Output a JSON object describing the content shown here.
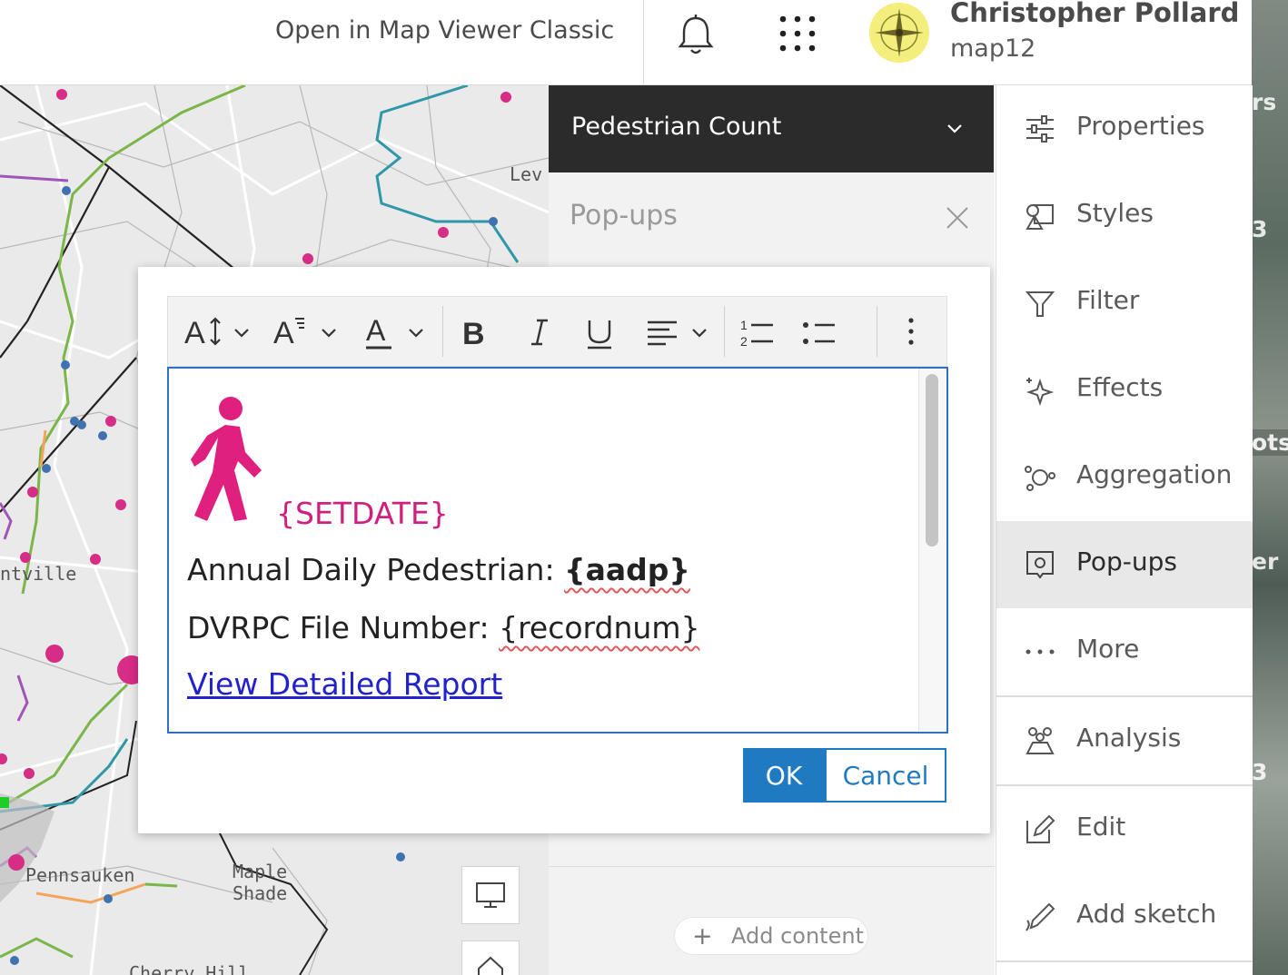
{
  "topbar": {
    "classic_link": "Open in Map Viewer Classic",
    "user_name": "Christopher Pollard",
    "user_id": "map12",
    "icons": [
      "bell-icon",
      "app-launcher-icon",
      "avatar"
    ]
  },
  "map": {
    "labels": [
      "Lev",
      "ntville",
      "Pennsauken",
      "Maple",
      "Shade",
      "Cherry Hill"
    ]
  },
  "panel": {
    "layer_title": "Pedestrian Count",
    "section_title": "Pop-ups",
    "add_content": "Add content"
  },
  "rightbar": {
    "items": [
      {
        "label": "Properties",
        "icon": "properties-icon"
      },
      {
        "label": "Styles",
        "icon": "styles-icon"
      },
      {
        "label": "Filter",
        "icon": "filter-icon"
      },
      {
        "label": "Effects",
        "icon": "effects-icon"
      },
      {
        "label": "Aggregation",
        "icon": "aggregation-icon"
      },
      {
        "label": "Pop-ups",
        "icon": "popups-icon",
        "active": true
      },
      {
        "label": "More",
        "icon": "more-icon"
      },
      {
        "label": "Analysis",
        "icon": "analysis-icon"
      },
      {
        "label": "Edit",
        "icon": "edit-icon"
      },
      {
        "label": "Add sketch",
        "icon": "add-sketch-icon"
      }
    ]
  },
  "background_texts": [
    "rs",
    "3",
    "ots",
    "er",
    "3"
  ],
  "editor": {
    "setdate": "{SETDATE}",
    "line1_label": "Annual Daily Pedestrian: ",
    "line1_field": "{aadp}",
    "line2_label": "DVRPC File Number: ",
    "line2_field": "{recordnum}",
    "link_text": "View Detailed Report"
  },
  "buttons": {
    "ok": "OK",
    "cancel": "Cancel"
  },
  "colors": {
    "accent": "#1f7ac1",
    "pedestrian": "#e0207f",
    "header_bg": "#2b2b2b"
  }
}
